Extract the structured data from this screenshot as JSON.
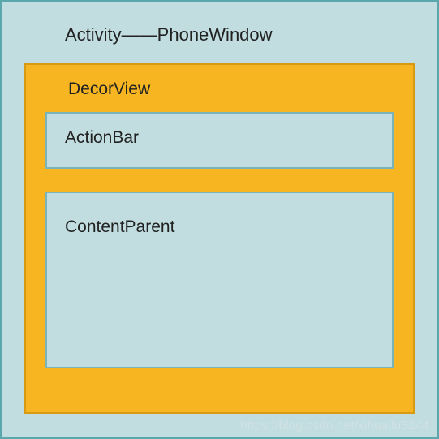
{
  "outer": {
    "title": "Activity——PhoneWindow"
  },
  "decorView": {
    "title": "DecorView",
    "actionBar": {
      "label": "ActionBar"
    },
    "contentParent": {
      "label": "ContentParent"
    }
  },
  "watermark": "https://blog.csdn.net/xihuailu3244"
}
